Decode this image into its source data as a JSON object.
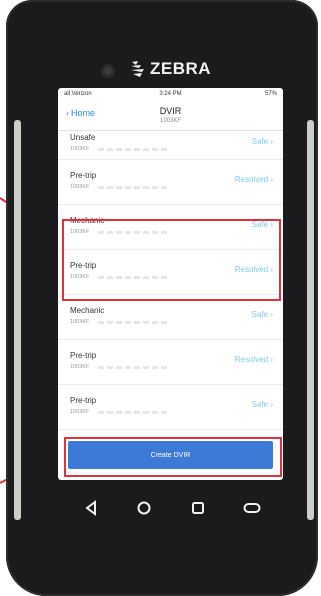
{
  "device": {
    "brand": "ZEBRA"
  },
  "status_bar": {
    "carrier": "all Verizon",
    "time": "3:24 PM",
    "battery": "57%"
  },
  "nav": {
    "back_label": "Home",
    "title": "DVIR",
    "subtitle": "1003KF"
  },
  "list": [
    {
      "label": "Unsafe",
      "sub": "1003KF",
      "status": "Safe"
    },
    {
      "label": "Pre-trip",
      "sub": "1003KF",
      "status": "Resolved"
    },
    {
      "label": "Mechanic",
      "sub": "1003KF",
      "status": "Safe"
    },
    {
      "label": "Pre-trip",
      "sub": "1003KF",
      "status": "Resolved"
    },
    {
      "label": "Mechanic",
      "sub": "1003KF",
      "status": "Safe"
    },
    {
      "label": "Pre-trip",
      "sub": "1003KF",
      "status": "Resolved"
    },
    {
      "label": "Pre-trip",
      "sub": "1003KF",
      "status": "Safe"
    }
  ],
  "create_button": "Create DVIR",
  "colors": {
    "accent_link": "#2d8be0",
    "status_text": "#7fc9e8",
    "button_bg": "#3d7ad8",
    "highlight": "#e0313c"
  },
  "icons": {
    "back": "chevron-left-icon",
    "row_arrow": "chevron-right-icon",
    "nav_back": "triangle-back-icon",
    "nav_home": "circle-home-icon",
    "nav_recents": "square-recents-icon",
    "nav_extra": "rounded-rect-icon"
  }
}
